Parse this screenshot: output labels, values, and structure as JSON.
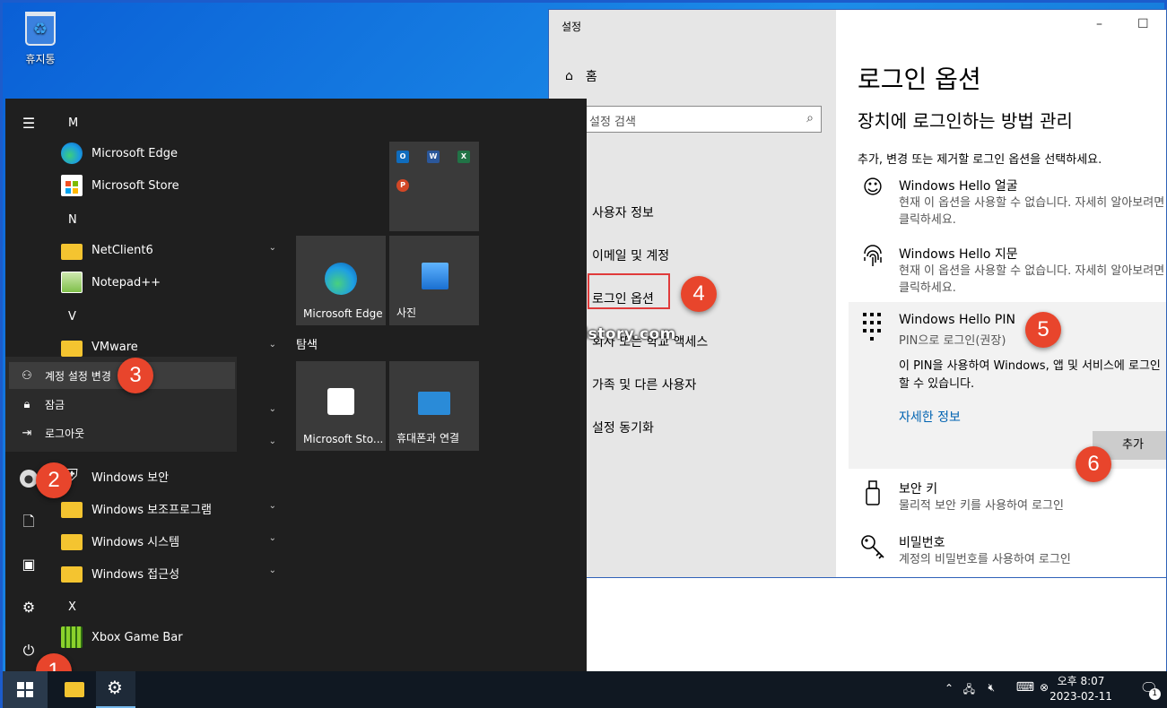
{
  "desktop": {
    "recycle_bin_label": "휴지통"
  },
  "settings": {
    "window_title": "설정",
    "home_label": "홈",
    "search_placeholder": "설정 검색",
    "nav": [
      "사용자 정보",
      "이메일 및 계정",
      "로그인 옵션",
      "회사 또는 학교 액세스",
      "가족 및 다른 사용자",
      "설정 동기화"
    ],
    "page_title": "로그인 옵션",
    "page_subtitle": "장치에 로그인하는 방법 관리",
    "page_desc": "추가, 변경 또는 제거할 로그인 옵션을 선택하세요.",
    "options": {
      "face": {
        "title": "Windows Hello 얼굴",
        "desc": "현재 이 옵션을 사용할 수 없습니다. 자세히 알아보려면 클릭하세요."
      },
      "fingerprint": {
        "title": "Windows Hello 지문",
        "desc": "현재 이 옵션을 사용할 수 없습니다. 자세히 알아보려면 클릭하세요."
      },
      "pin": {
        "title": "Windows Hello PIN",
        "subtitle": "PIN으로 로그인(권장)",
        "desc": "이 PIN을 사용하여 Windows, 앱 및 서비스에 로그인할 수 있습니다.",
        "link": "자세한 정보",
        "add_button": "추가"
      },
      "security_key": {
        "title": "보안 키",
        "desc": "물리적 보안 키를 사용하여 로그인"
      },
      "password": {
        "title": "비밀번호",
        "desc": "계정의 비밀번호를 사용하여 로그인"
      }
    },
    "watermark": "fosterahope.tistory.com"
  },
  "start_menu": {
    "letters": {
      "m": "M",
      "n": "N",
      "v": "V",
      "x": "X"
    },
    "apps": {
      "edge": "Microsoft Edge",
      "store": "Microsoft Store",
      "netclient": "NetClient6",
      "notepad": "Notepad++",
      "vmware": "VMware",
      "win_security": "Windows 보안",
      "win_accessories": "Windows 보조프로그램",
      "win_system": "Windows 시스템",
      "win_accessibility": "Windows 접근성",
      "xbox": "Xbox Game Bar"
    },
    "account_menu": {
      "change_settings": "계정 설정 변경",
      "lock": "잠금",
      "sign_out": "로그아웃"
    },
    "tiles_group_label": "탐색",
    "tiles": {
      "edge": "Microsoft Edge",
      "photos": "사진",
      "store": "Microsoft Sto...",
      "phone": "휴대폰과 연결"
    }
  },
  "badges": [
    "1",
    "2",
    "3",
    "4",
    "5",
    "6"
  ],
  "taskbar": {
    "time": "오후 8:07",
    "date": "2023-02-11",
    "notification_count": "1"
  },
  "colors": {
    "accent": "#0063b1",
    "badge": "#e8452c",
    "highlight_border": "#e03b3b",
    "start_bg": "#1f1f1f",
    "taskbar_bg": "#101822"
  }
}
